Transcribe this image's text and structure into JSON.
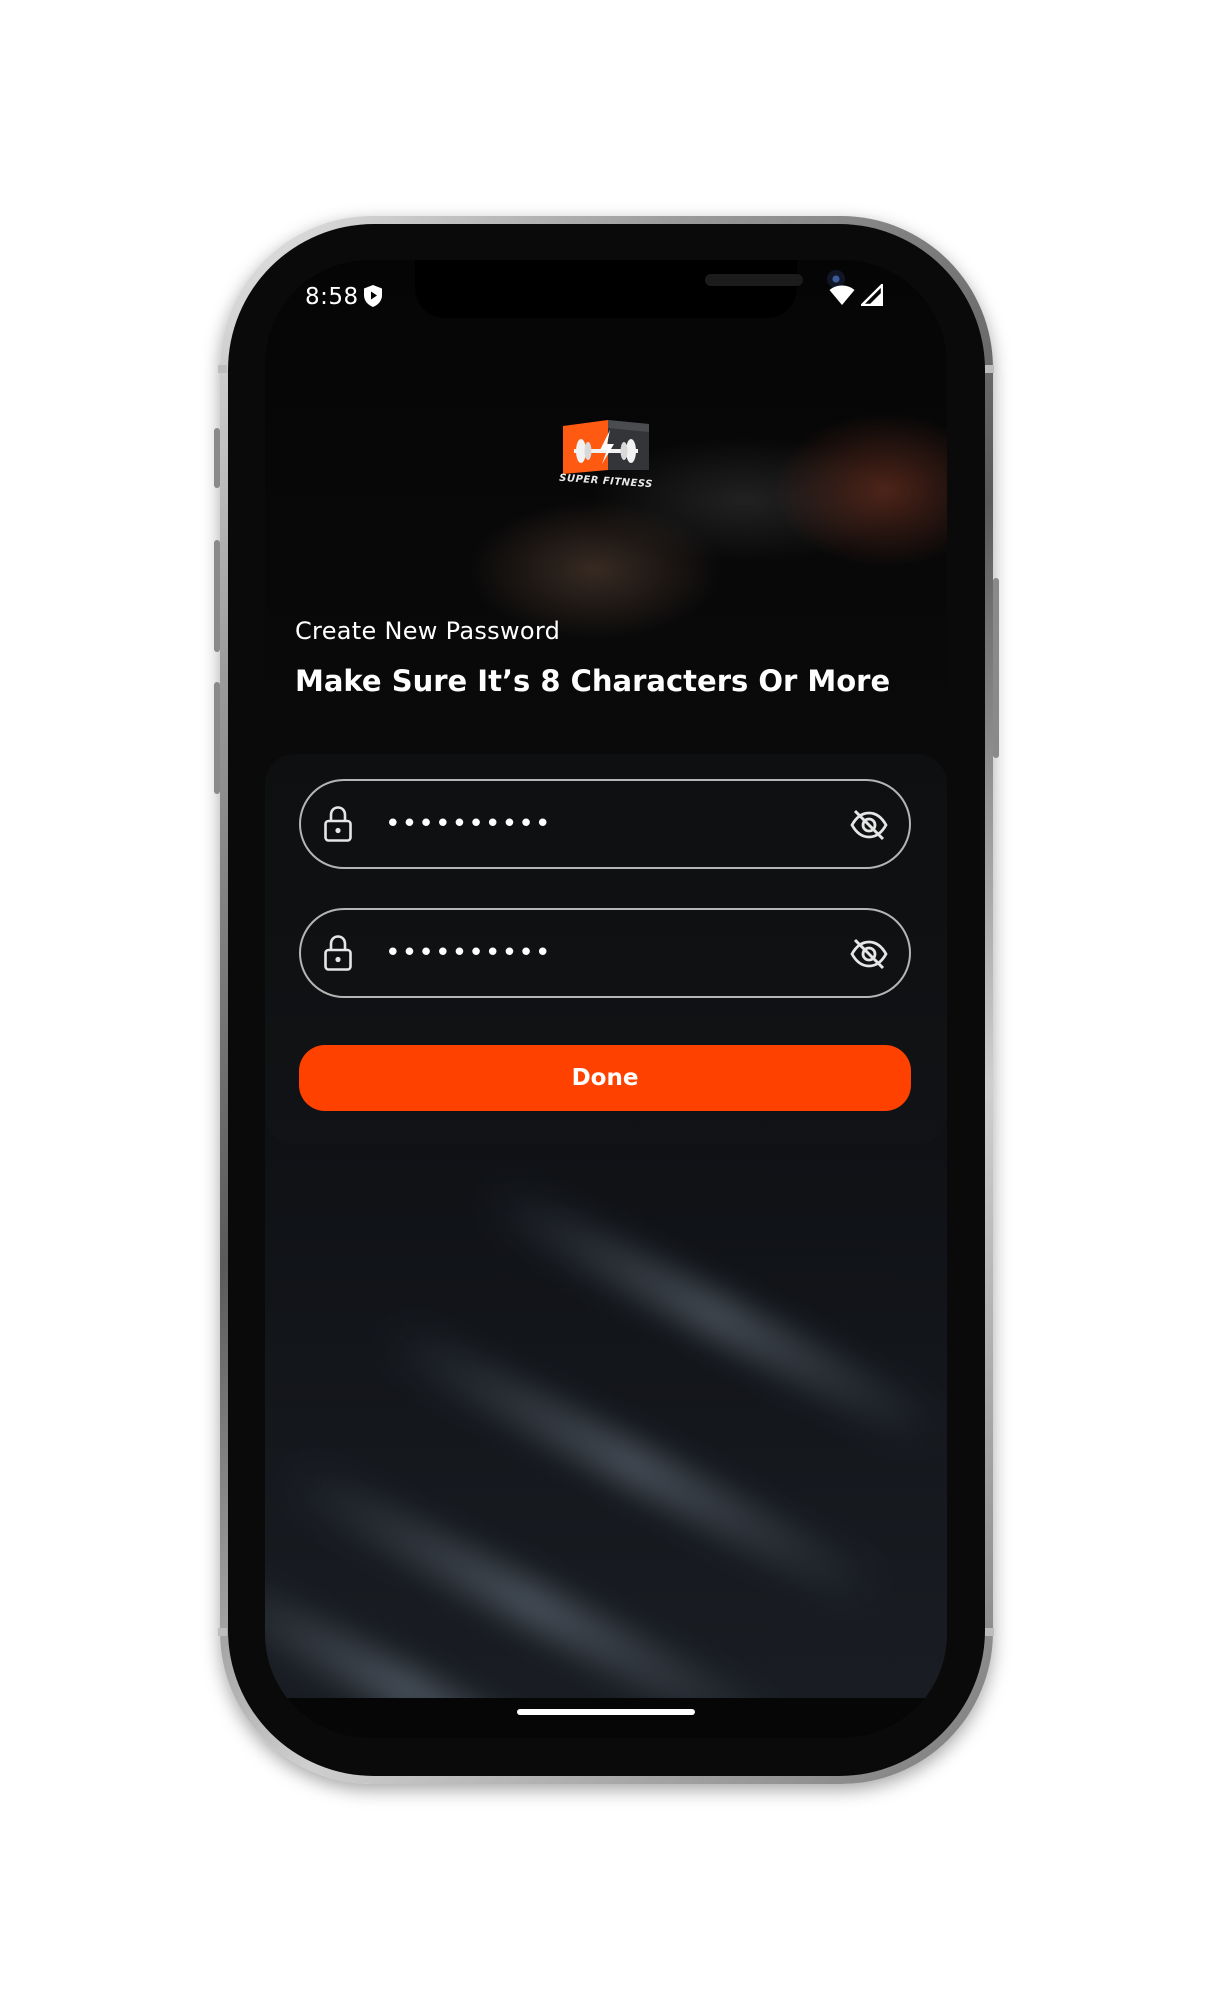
{
  "status_bar": {
    "time": "8:58",
    "icons": [
      "shield-play-icon",
      "wifi-icon",
      "signal-icon"
    ]
  },
  "logo": {
    "text": "SUPER FITNESS",
    "colors": {
      "accent": "#ff5a12"
    }
  },
  "screen": {
    "subtitle": "Create New Password",
    "title": "Make Sure It’s 8 Characters Or More"
  },
  "form": {
    "password": {
      "value": "••••••••••",
      "leading_icon": "lock-icon",
      "trailing_icon": "eye-off-icon"
    },
    "confirm_password": {
      "value": "••••••••••",
      "leading_icon": "lock-icon",
      "trailing_icon": "eye-off-icon"
    },
    "done_label": "Done"
  },
  "colors": {
    "primary": "#ff4100",
    "text": "#ffffff",
    "field_border": "#d2d2d2"
  }
}
